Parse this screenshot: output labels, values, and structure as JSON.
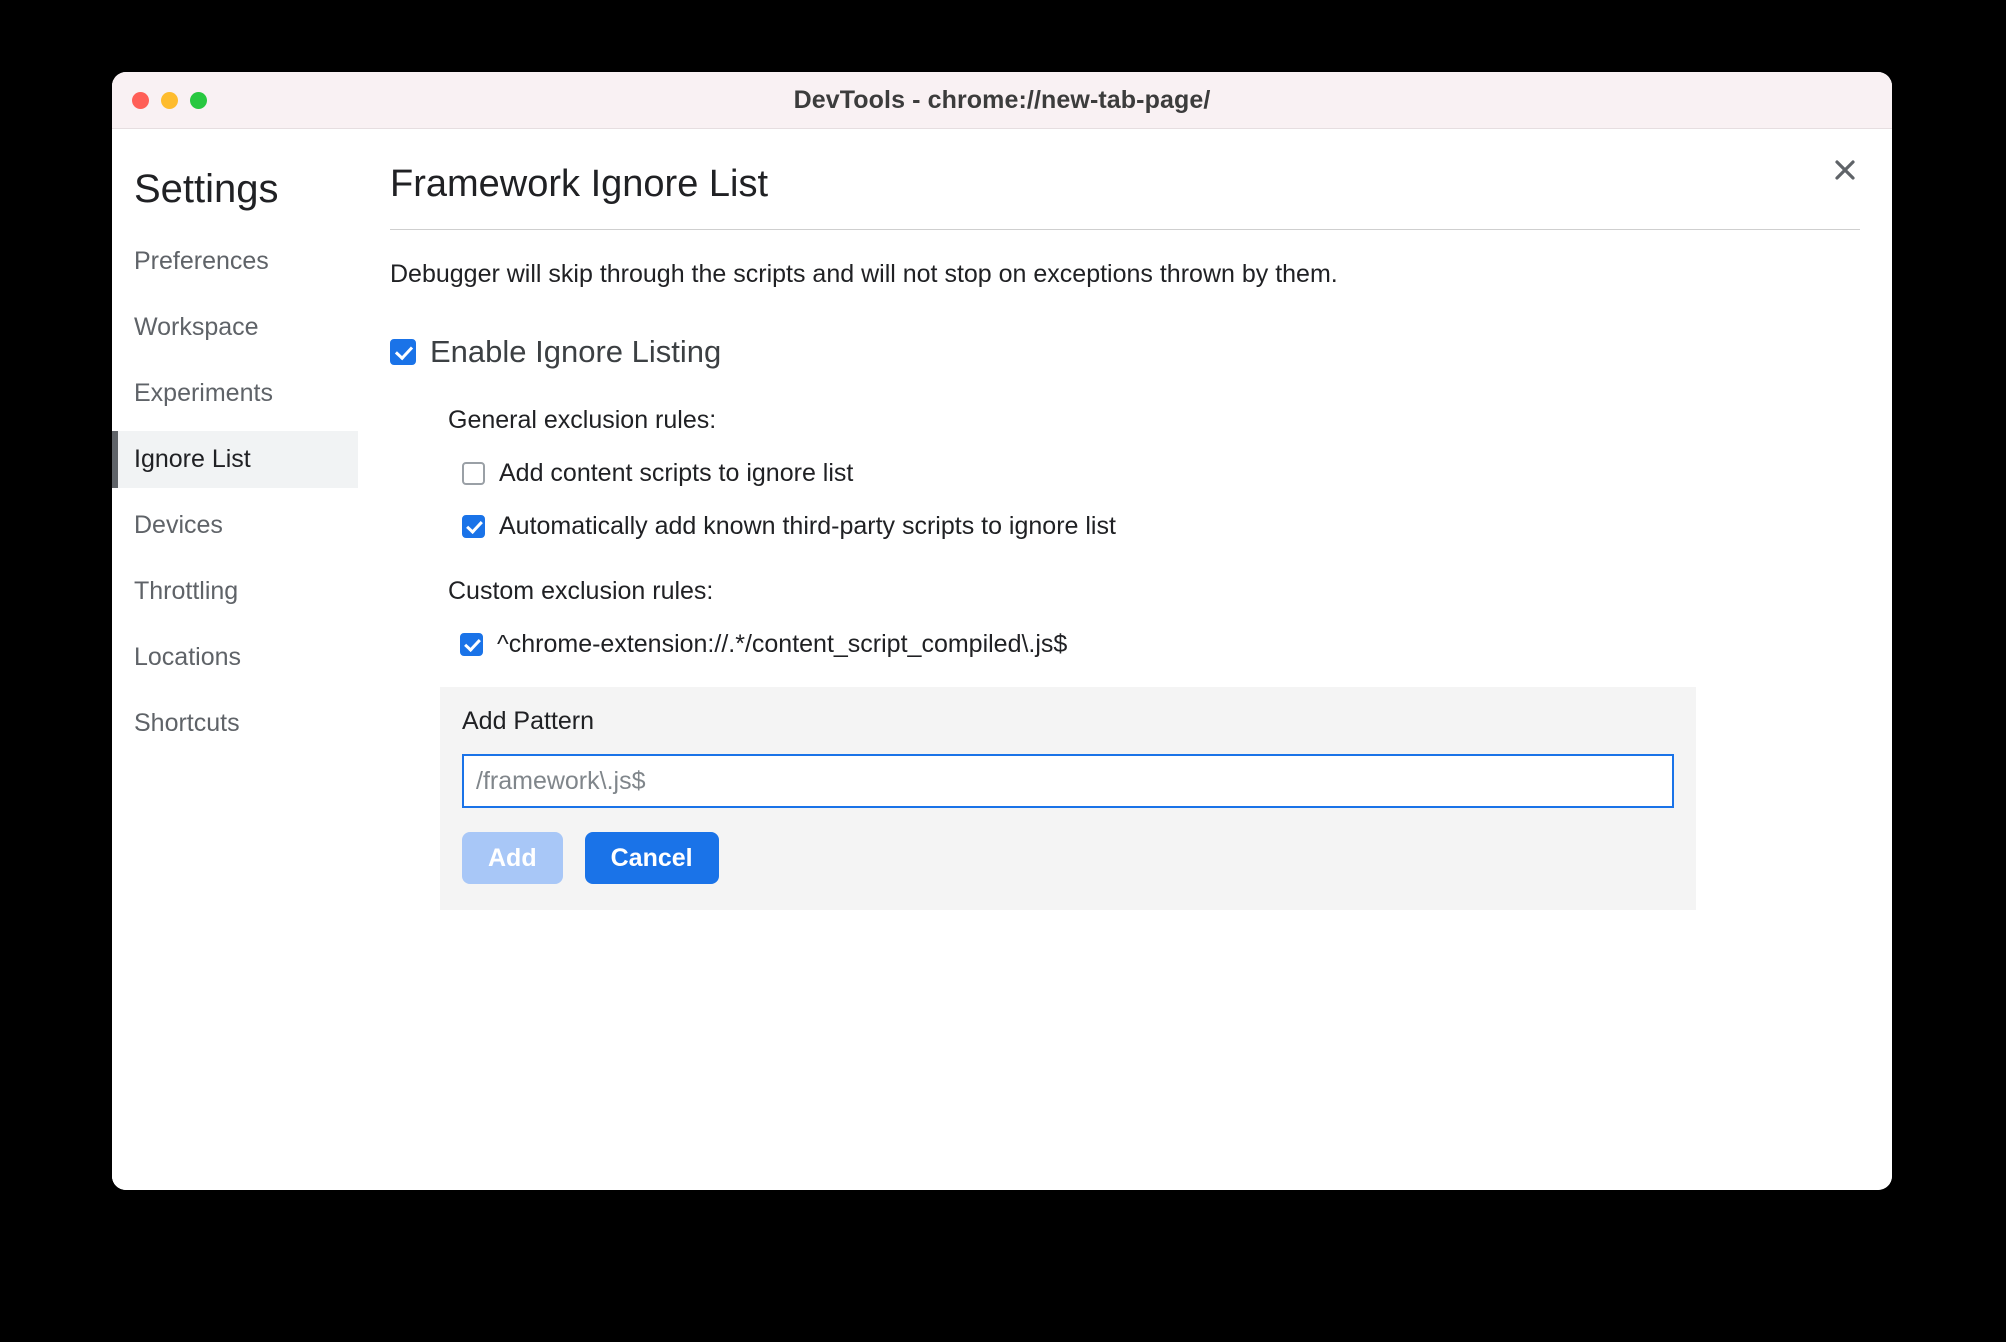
{
  "window": {
    "title": "DevTools - chrome://new-tab-page/",
    "traffic_lights": {
      "close": "close-window",
      "minimize": "minimize-window",
      "maximize": "maximize-window"
    }
  },
  "sidebar": {
    "title": "Settings",
    "items": [
      {
        "label": "Preferences",
        "selected": false
      },
      {
        "label": "Workspace",
        "selected": false
      },
      {
        "label": "Experiments",
        "selected": false
      },
      {
        "label": "Ignore List",
        "selected": true
      },
      {
        "label": "Devices",
        "selected": false
      },
      {
        "label": "Throttling",
        "selected": false
      },
      {
        "label": "Locations",
        "selected": false
      },
      {
        "label": "Shortcuts",
        "selected": false
      }
    ]
  },
  "panel": {
    "title": "Framework Ignore List",
    "description": "Debugger will skip through the scripts and will not stop on exceptions thrown by them.",
    "close_icon": "close-icon",
    "enable": {
      "label": "Enable Ignore Listing",
      "checked": true
    },
    "general_rules": {
      "label": "General exclusion rules:",
      "items": [
        {
          "label": "Add content scripts to ignore list",
          "checked": false
        },
        {
          "label": "Automatically add known third-party scripts to ignore list",
          "checked": true
        }
      ]
    },
    "custom_rules": {
      "label": "Custom exclusion rules:",
      "items": [
        {
          "label": "^chrome-extension://.*/content_script_compiled\\.js$",
          "checked": true
        }
      ]
    },
    "add_pattern": {
      "title": "Add Pattern",
      "input_value": "",
      "input_placeholder": "/framework\\.js$",
      "add_label": "Add",
      "add_disabled": true,
      "cancel_label": "Cancel"
    }
  },
  "colors": {
    "accent_blue": "#1a73e8",
    "accent_blue_disabled": "#a8c7f7",
    "titlebar_bg": "#f9f1f3",
    "selected_nav_bg": "#f1f3f4",
    "panel_bg": "#f4f4f4"
  }
}
